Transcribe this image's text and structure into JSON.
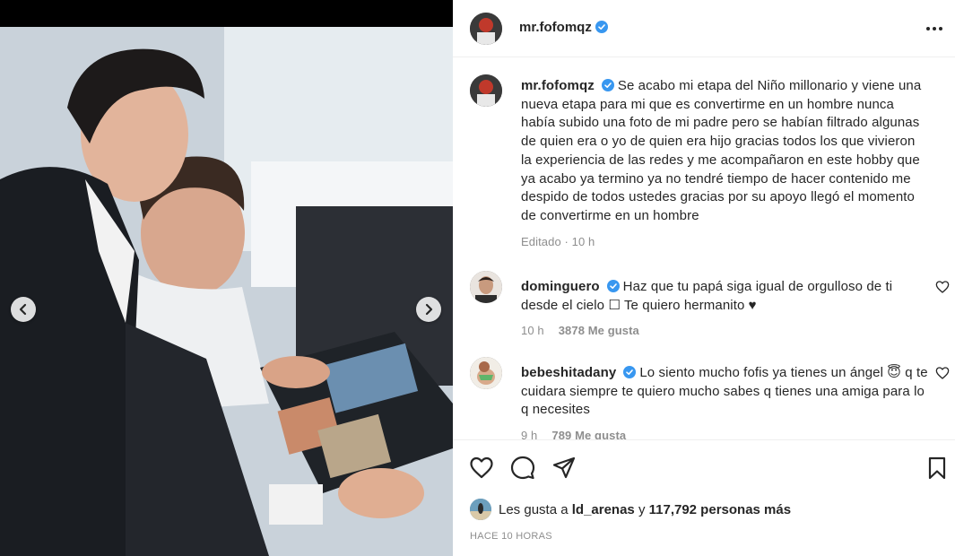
{
  "post": {
    "author": "mr.fofomqz",
    "caption": "Se acabo mi etapa del Niño millonario y viene una nueva etapa para mi que es convertirme en un hombre nunca había subido una foto de mi padre pero se habían filtrado algunas de quien era o yo de quien era hijo gracias todos los que vivieron la experiencia de las redes y me acompañaron en este hobby que ya acabo ya termino ya no tendré tiempo de hacer contenido me despido de todos ustedes gracias por su apoyo llegó el momento de convertirme en un hombre",
    "caption_meta": "Editado · 10 h"
  },
  "comments": [
    {
      "user": "dominguero",
      "text": "Haz que tu papá siga igual de orgulloso de ti desde el cielo ☐ Te quiero hermanito ♥",
      "time": "10 h",
      "likes": "3878 Me gusta"
    },
    {
      "user": "bebeshitadany",
      "text": "Lo siento mucho fofis ya tienes un ángel 😇 q te cuidara siempre te quiero mucho sabes q tienes una amiga para lo q necesites",
      "time": "9 h",
      "likes": "789 Me gusta"
    }
  ],
  "likes_summary": {
    "prefix": "Les gusta a",
    "user": "ld_arenas",
    "middle": "y",
    "count": "117,792 personas más"
  },
  "timestamp": "HACE 10 HORAS",
  "icons": {
    "verified": "verified-badge-icon",
    "more": "more-options-icon",
    "like": "heart-icon",
    "comment": "comment-bubble-icon",
    "share": "paper-plane-icon",
    "save": "bookmark-icon",
    "prev": "chevron-left-icon",
    "next": "chevron-right-icon"
  },
  "colors": {
    "verified": "#3897f0",
    "text": "#262626",
    "muted": "#8e8e8e",
    "border": "#efefef"
  }
}
